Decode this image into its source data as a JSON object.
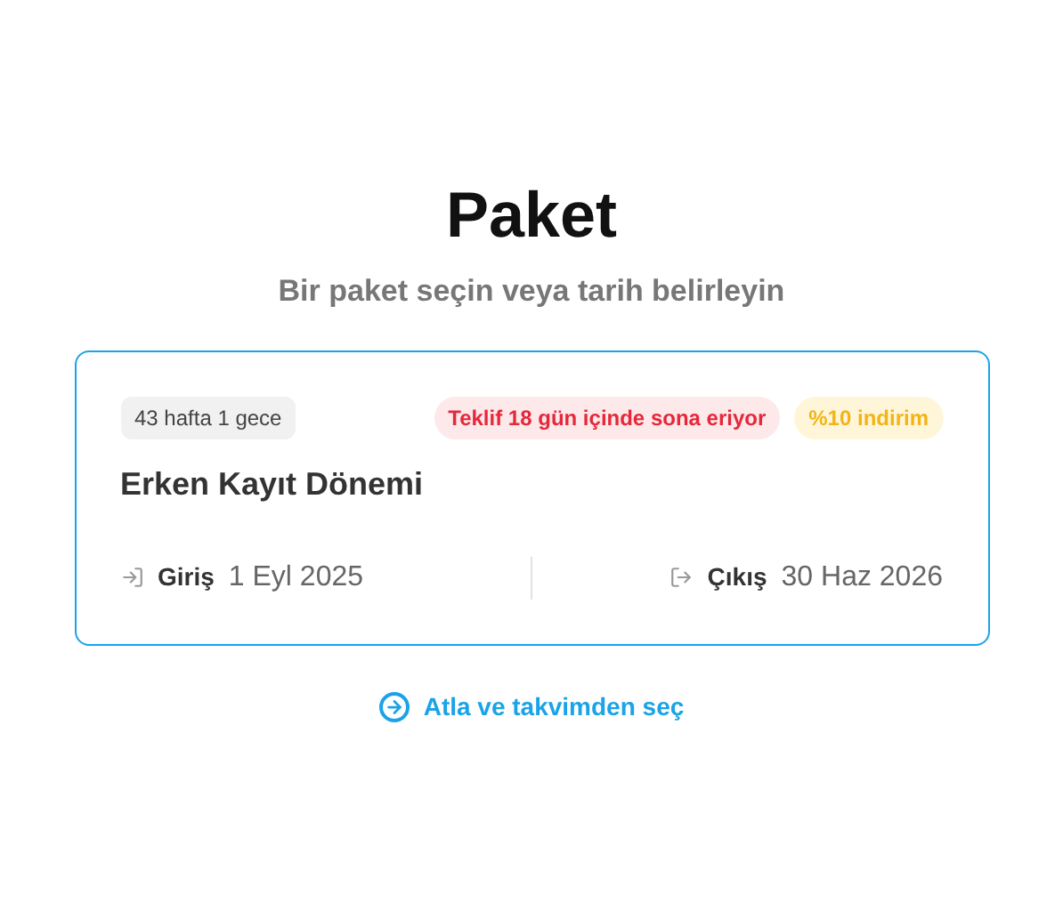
{
  "title": "Paket",
  "subtitle": "Bir paket seçin veya tarih belirleyin",
  "package": {
    "duration": "43 hafta 1 gece",
    "badges": [
      {
        "text": "Teklif 18 gün içinde sona eriyor",
        "kind": "expiry"
      },
      {
        "text": "%10 indirim",
        "kind": "discount"
      }
    ],
    "name": "Erken Kayıt Dönemi",
    "selected": true,
    "check_in": {
      "label": "Giriş",
      "date": "1 Eyl 2025"
    },
    "check_out": {
      "label": "Çıkış",
      "date": "30 Haz 2026"
    }
  },
  "skip_link": "Atla ve takvimden seç"
}
